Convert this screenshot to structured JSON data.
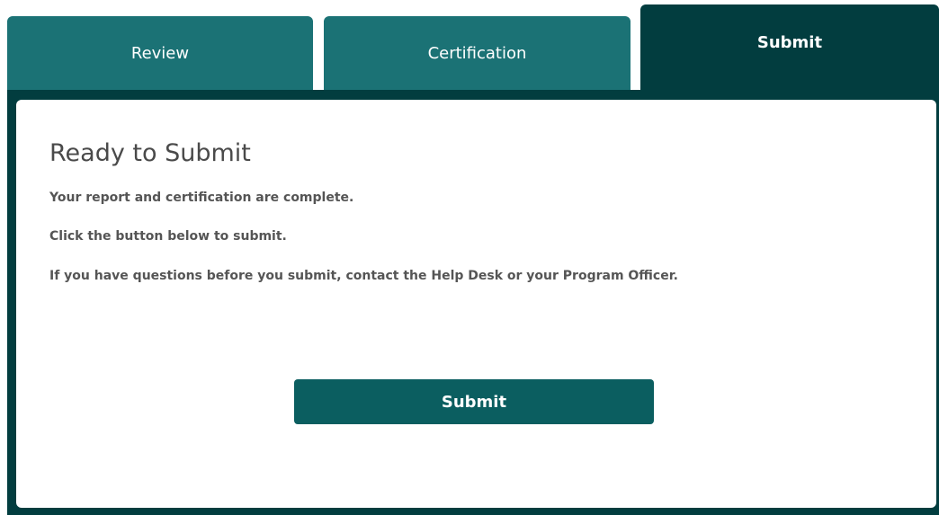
{
  "tabs": [
    {
      "label": "Review"
    },
    {
      "label": "Certification"
    },
    {
      "label": "Submit"
    }
  ],
  "active_tab": "Submit",
  "colors": {
    "tab_inactive": "#1b7275",
    "tab_active": "#023d3f",
    "button": "#0b5e60",
    "text": "#555555"
  },
  "card": {
    "title": "Ready to Submit",
    "lines": [
      "Your report and certification are complete.",
      "Click the button below to submit.",
      "If you have questions before you submit, contact the Help Desk or your Program Officer."
    ],
    "submit_label": "Submit"
  }
}
